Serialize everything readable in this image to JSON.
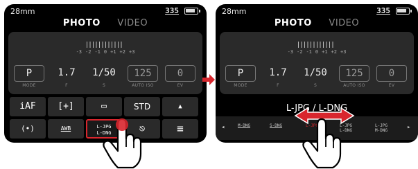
{
  "left": {
    "focal": "28mm",
    "shots": "335",
    "modes": [
      "PHOTO",
      "VIDEO"
    ],
    "ev_scale": [
      "-3",
      "-2",
      "-1",
      "0",
      "+1",
      "+2",
      "+3"
    ],
    "params": [
      {
        "value": "P",
        "label": "MODE"
      },
      {
        "value": "1.7",
        "label": "F"
      },
      {
        "value": "1/50",
        "label": "S"
      },
      {
        "value": "125",
        "label": "AUTO ISO"
      },
      {
        "value": "0",
        "label": "EV"
      }
    ],
    "grid_top": [
      "iAF",
      "[+]",
      "▭",
      "STD",
      "▲"
    ],
    "grid_bottom": [
      "(•)",
      "AWB",
      "L-JPG L-DNG",
      "⎋",
      "≡"
    ]
  },
  "right": {
    "focal": "28mm",
    "shots": "335",
    "modes": [
      "PHOTO",
      "VIDEO"
    ],
    "ev_scale": [
      "-3",
      "-2",
      "-1",
      "0",
      "+1",
      "+2",
      "+3"
    ],
    "params": [
      {
        "value": "P",
        "label": "MODE"
      },
      {
        "value": "1.7",
        "label": "F"
      },
      {
        "value": "1/50",
        "label": "S"
      },
      {
        "value": "125",
        "label": "AUTO ISO"
      },
      {
        "value": "0",
        "label": "EV"
      }
    ],
    "format_title": "L-JPG / L-DNG",
    "format_options": [
      "M-DNG",
      "S-DNG",
      "L-JPG",
      "L-JPG L-DNG",
      "L-JPG M-DNG"
    ]
  },
  "colors": {
    "accent": "#d8262d",
    "screen": "#000000",
    "panel": "#2a2a2a"
  },
  "battery_level": 0.75
}
